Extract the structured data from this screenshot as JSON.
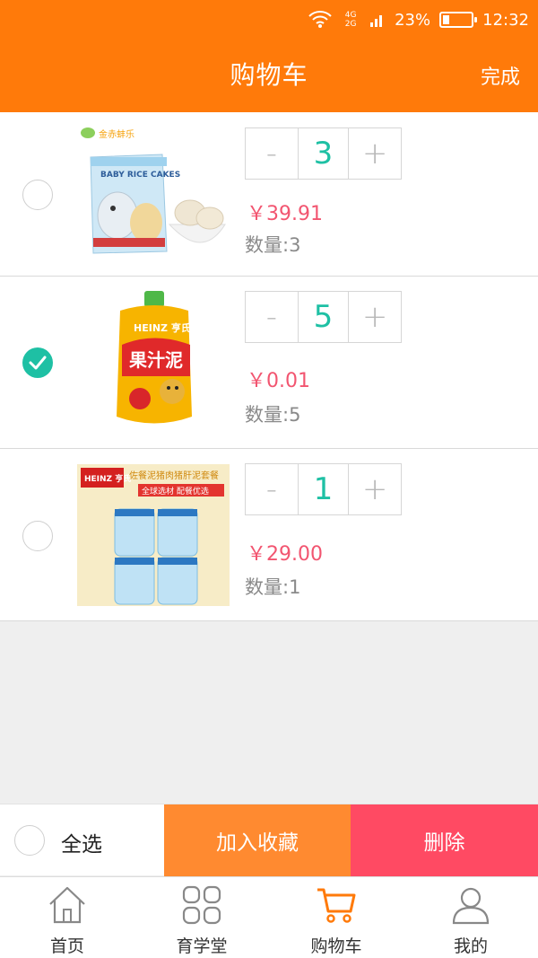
{
  "status_bar": {
    "network": "4G 2G",
    "battery_percent": "23%",
    "battery_level": 0.23,
    "time": "12:32"
  },
  "header": {
    "title": "购物车",
    "done_label": "完成"
  },
  "cart_items": [
    {
      "brand_text": "金赤蚌乐",
      "product_text": "BABY RICE CAKES",
      "quantity_value": "3",
      "price": "￥39.91",
      "count_label": "数量:3",
      "selected": false
    },
    {
      "brand_text": "HEINZ 亨氏",
      "product_text": "果汁泥",
      "quantity_value": "5",
      "price": "￥0.01",
      "count_label": "数量:5",
      "selected": true
    },
    {
      "brand_text": "HEINZ 亨氏",
      "product_text": "佐餐泥猪肉猪肝泥套餐",
      "banner_text": "全球选材  配餐优选",
      "quantity_value": "1",
      "price": "￥29.00",
      "count_label": "数量:1",
      "selected": false
    }
  ],
  "stepper": {
    "minus": "-",
    "plus": "+"
  },
  "action_bar": {
    "select_all_label": "全选",
    "favorite_label": "加入收藏",
    "delete_label": "删除"
  },
  "tabs": [
    {
      "label": "首页",
      "icon": "home-icon"
    },
    {
      "label": "育学堂",
      "icon": "grid-icon"
    },
    {
      "label": "购物车",
      "icon": "cart-icon",
      "active": true
    },
    {
      "label": "我的",
      "icon": "profile-icon"
    }
  ],
  "colors": {
    "primary": "#ff7a0a",
    "accent": "#1ec0a4",
    "price": "#f25570",
    "favorite": "#ff8a30",
    "delete": "#ff4a63"
  }
}
